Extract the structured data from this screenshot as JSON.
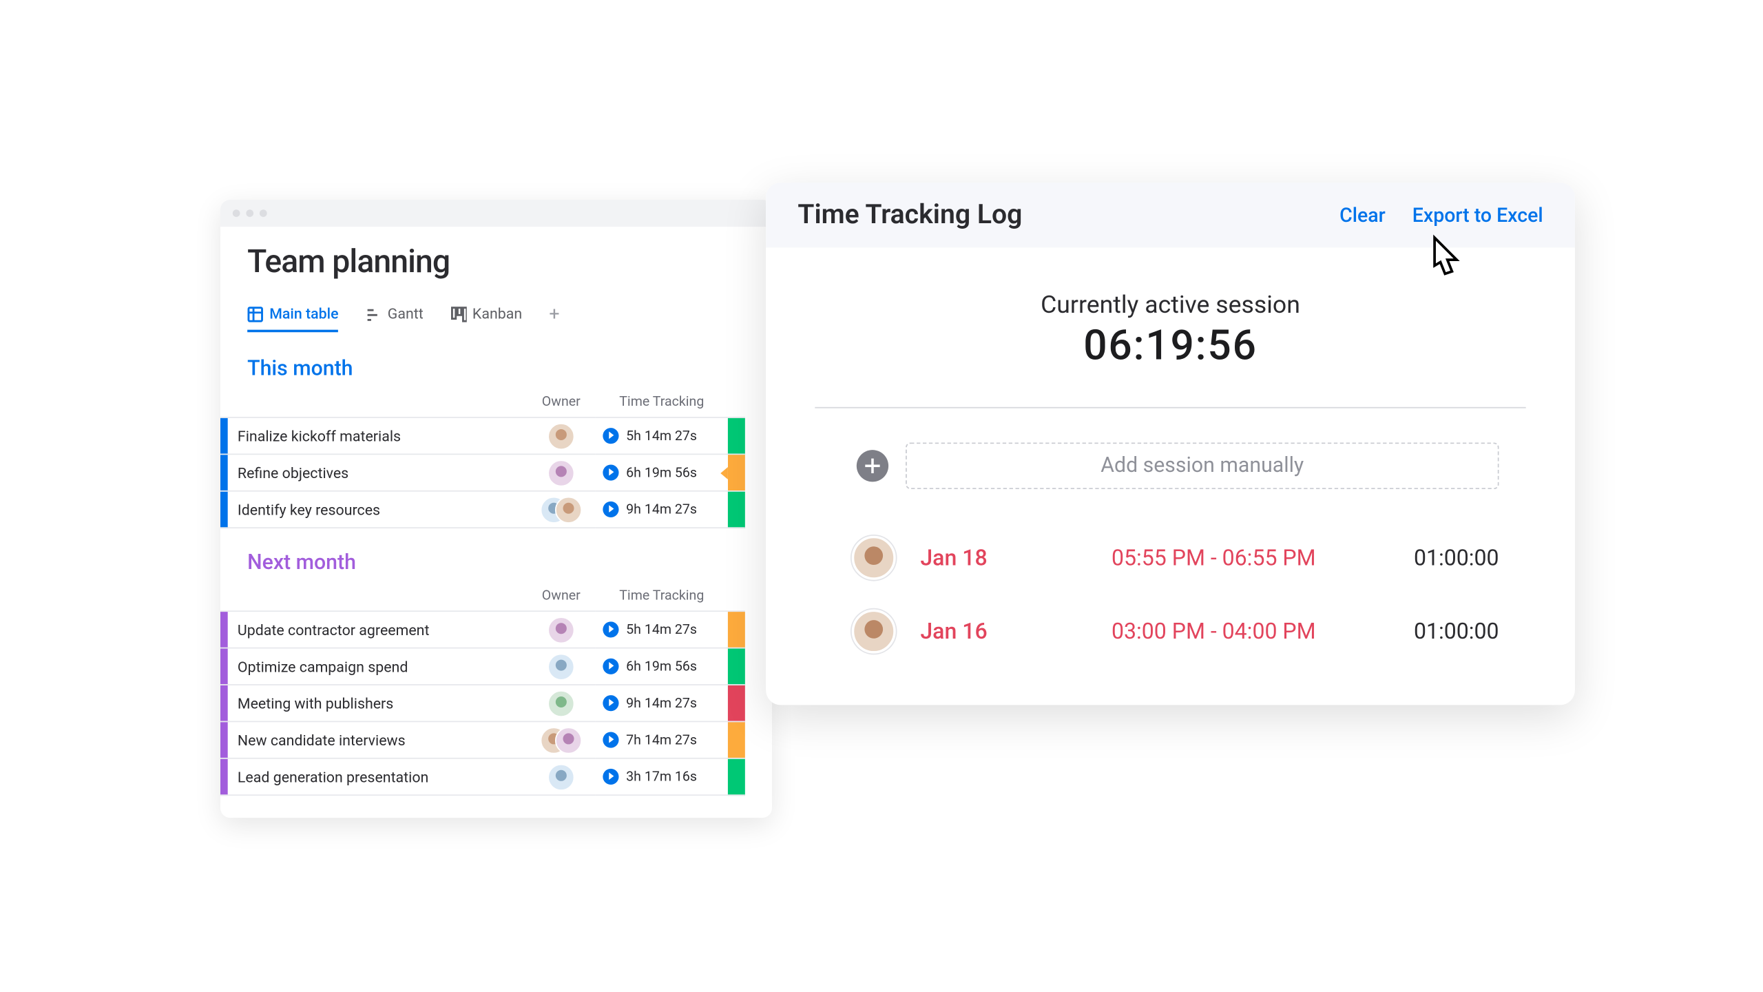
{
  "board": {
    "title": "Team planning",
    "views": [
      {
        "label": "Main table",
        "active": true
      },
      {
        "label": "Gantt",
        "active": false
      },
      {
        "label": "Kanban",
        "active": false
      }
    ],
    "columns": {
      "owner": "Owner",
      "time": "Time Tracking"
    },
    "groups": [
      {
        "name": "This month",
        "color_class": "this",
        "title_class": "group-this",
        "rows": [
          {
            "name": "Finalize kickoff materials",
            "owners": [
              "a1"
            ],
            "time": "5h 14m 27s",
            "status": "green"
          },
          {
            "name": "Refine objectives",
            "owners": [
              "a3"
            ],
            "time": "6h 19m 56s",
            "status": "orange",
            "notch": true
          },
          {
            "name": "Identify key resources",
            "owners": [
              "a2",
              "a1"
            ],
            "time": "9h 14m 27s",
            "status": "green"
          }
        ]
      },
      {
        "name": "Next month",
        "color_class": "next",
        "title_class": "group-next",
        "rows": [
          {
            "name": "Update contractor agreement",
            "owners": [
              "a3"
            ],
            "time": "5h 14m 27s",
            "status": "orange"
          },
          {
            "name": "Optimize campaign spend",
            "owners": [
              "a2"
            ],
            "time": "6h 19m 56s",
            "status": "green"
          },
          {
            "name": "Meeting with publishers",
            "owners": [
              "a4"
            ],
            "time": "9h 14m 27s",
            "status": "red"
          },
          {
            "name": "New candidate interviews",
            "owners": [
              "a1",
              "a3"
            ],
            "time": "7h 14m 27s",
            "status": "orange"
          },
          {
            "name": "Lead generation presentation",
            "owners": [
              "a2"
            ],
            "time": "3h 17m 16s",
            "status": "green"
          }
        ]
      }
    ]
  },
  "panel": {
    "title": "Time Tracking Log",
    "clear_label": "Clear",
    "export_label": "Export to Excel",
    "session_label": "Currently active session",
    "session_time": "06:19:56",
    "add_label": "Add session manually",
    "logs": [
      {
        "date": "Jan 18",
        "range": "05:55 PM - 06:55 PM",
        "duration": "01:00:00"
      },
      {
        "date": "Jan 16",
        "range": "03:00 PM - 04:00 PM",
        "duration": "01:00:00"
      }
    ]
  }
}
